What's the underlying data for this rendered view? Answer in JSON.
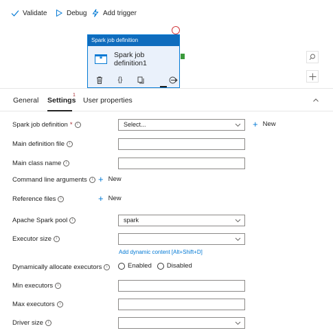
{
  "toolbar": {
    "validate_label": "Validate",
    "debug_label": "Debug",
    "add_trigger_label": "Add trigger"
  },
  "activity": {
    "header": "Spark job definition",
    "name": "Spark job definition1"
  },
  "tabs": {
    "general": "General",
    "settings": "Settings",
    "settings_badge": "1",
    "user_properties": "User properties"
  },
  "form": {
    "spark_job_definition": {
      "label": "Spark job definition",
      "required": "*",
      "value": "Select...",
      "new": "New"
    },
    "main_definition_file": {
      "label": "Main definition file",
      "value": ""
    },
    "main_class_name": {
      "label": "Main class name",
      "value": ""
    },
    "command_line_arguments": {
      "label": "Command line arguments",
      "new": "New"
    },
    "reference_files": {
      "label": "Reference files",
      "new": "New"
    },
    "apache_spark_pool": {
      "label": "Apache Spark pool",
      "value": "spark"
    },
    "executor_size": {
      "label": "Executor size",
      "value": "",
      "dynamic_link": "Add dynamic content [Alt+Shift+D]"
    },
    "dynamic_allocation": {
      "label": "Dynamically allocate executors",
      "enabled": "Enabled",
      "disabled": "Disabled"
    },
    "min_executors": {
      "label": "Min executors",
      "value": ""
    },
    "max_executors": {
      "label": "Max executors",
      "value": ""
    },
    "driver_size": {
      "label": "Driver size",
      "value": ""
    }
  },
  "colors": {
    "accent": "#0078d4",
    "node_header": "#0f6cbd",
    "required": "#a4262c",
    "success_handle": "#3c9a3c",
    "fail_handle": "#d13438"
  }
}
